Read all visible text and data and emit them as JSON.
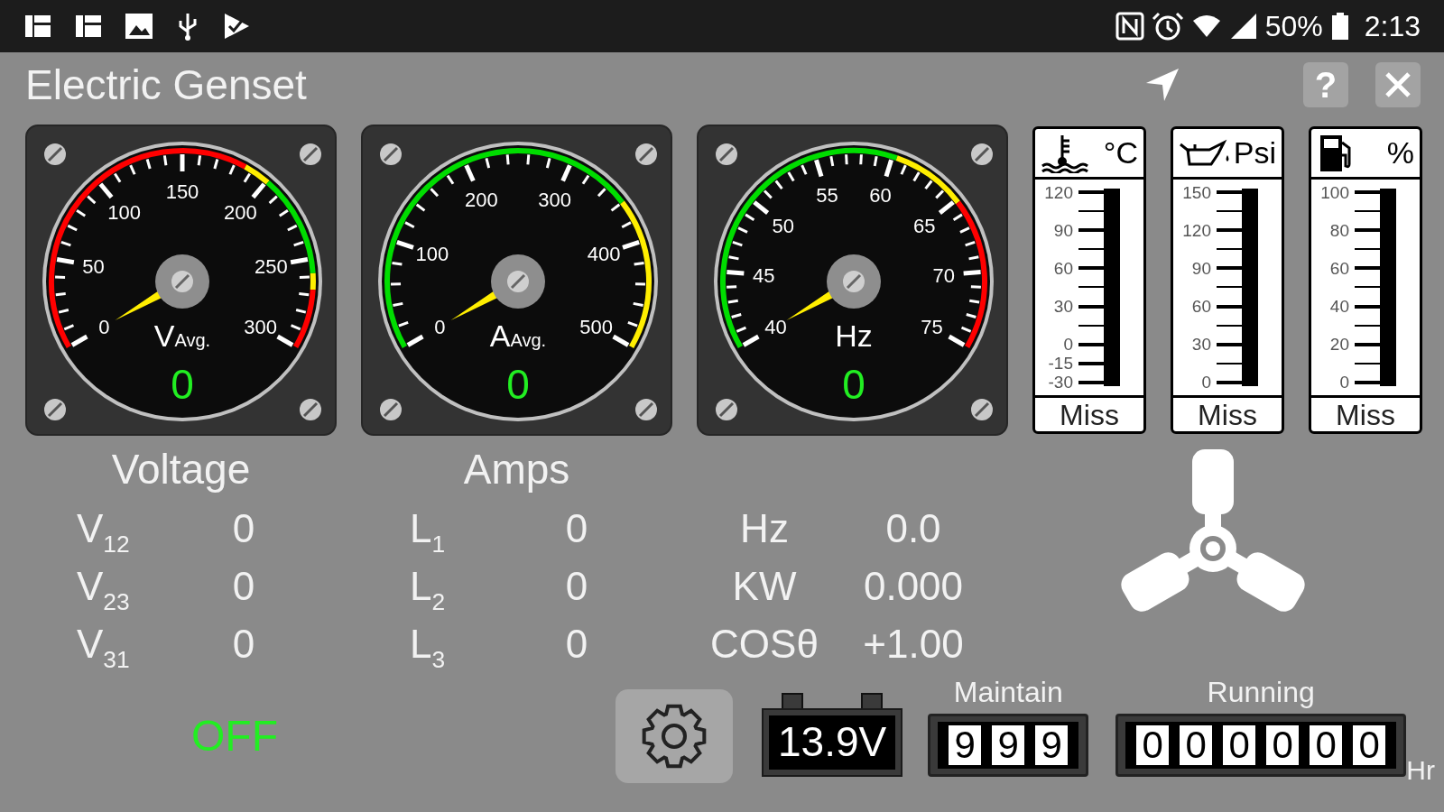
{
  "status_bar": {
    "battery_text": "50%",
    "time": "2:13"
  },
  "title": "Electric Genset",
  "help_button": "?",
  "gauges": [
    {
      "scale": [
        "0",
        "50",
        "100",
        "150",
        "200",
        "250",
        "300"
      ],
      "unit": "V",
      "unit_suffix": "Avg.",
      "value": "0"
    },
    {
      "scale": [
        "0",
        "100",
        "200",
        "300",
        "400",
        "500"
      ],
      "unit": "A",
      "unit_suffix": "Avg.",
      "value": "0"
    },
    {
      "scale": [
        "40",
        "45",
        "50",
        "55",
        "60",
        "65",
        "70",
        "75"
      ],
      "unit": "Hz",
      "value": "0"
    }
  ],
  "meters": [
    {
      "kind": "temperature",
      "unit": "°C",
      "status": "Miss",
      "ticks": [
        {
          "kind": "major",
          "label": "120"
        },
        {
          "kind": "minor"
        },
        {
          "kind": "major",
          "label": "90"
        },
        {
          "kind": "minor"
        },
        {
          "kind": "major",
          "label": "60"
        },
        {
          "kind": "minor"
        },
        {
          "kind": "major",
          "label": "30"
        },
        {
          "kind": "minor"
        },
        {
          "kind": "major",
          "label": "0"
        },
        {
          "kind": "major",
          "label": "-15"
        },
        {
          "kind": "major",
          "label": "-30"
        }
      ]
    },
    {
      "kind": "oil",
      "unit": "Psi",
      "status": "Miss",
      "ticks": [
        {
          "kind": "major",
          "label": "150"
        },
        {
          "kind": "minor"
        },
        {
          "kind": "major",
          "label": "120"
        },
        {
          "kind": "minor"
        },
        {
          "kind": "major",
          "label": "90"
        },
        {
          "kind": "minor"
        },
        {
          "kind": "major",
          "label": "60"
        },
        {
          "kind": "minor"
        },
        {
          "kind": "major",
          "label": "30"
        },
        {
          "kind": "minor"
        },
        {
          "kind": "major",
          "label": "0"
        }
      ]
    },
    {
      "kind": "fuel",
      "unit": "%",
      "status": "Miss",
      "ticks": [
        {
          "kind": "major",
          "label": "100"
        },
        {
          "kind": "minor"
        },
        {
          "kind": "major",
          "label": "80"
        },
        {
          "kind": "minor"
        },
        {
          "kind": "major",
          "label": "60"
        },
        {
          "kind": "minor"
        },
        {
          "kind": "major",
          "label": "40"
        },
        {
          "kind": "minor"
        },
        {
          "kind": "major",
          "label": "20"
        },
        {
          "kind": "minor"
        },
        {
          "kind": "major",
          "label": "0"
        }
      ]
    }
  ],
  "readings": [
    {
      "title": "Voltage",
      "rows": [
        {
          "label": "V$_{12}$",
          "value": "0"
        },
        {
          "label": "V$_{23}$",
          "value": "0"
        },
        {
          "label": "V$_{31}$",
          "value": "0"
        }
      ]
    },
    {
      "title": "Amps",
      "rows": [
        {
          "label": "L$_{1}$",
          "value": "0"
        },
        {
          "label": "L$_{2}$",
          "value": "0"
        },
        {
          "label": "L$_{3}$",
          "value": "0"
        }
      ]
    },
    {
      "rows": [
        {
          "label": "Hz",
          "value": "0.0"
        },
        {
          "label": "KW",
          "value": "0.000"
        },
        {
          "label": "COSθ",
          "value": "+1.00"
        }
      ]
    }
  ],
  "engine_state": "OFF",
  "battery_voltage": "13.9V",
  "maintain": {
    "label": "Maintain",
    "digits": [
      "9",
      "9",
      "9"
    ]
  },
  "running": {
    "label": "Running",
    "digits": [
      "0",
      "0",
      "0",
      "0",
      "0",
      "0"
    ],
    "unit": "Hr"
  }
}
